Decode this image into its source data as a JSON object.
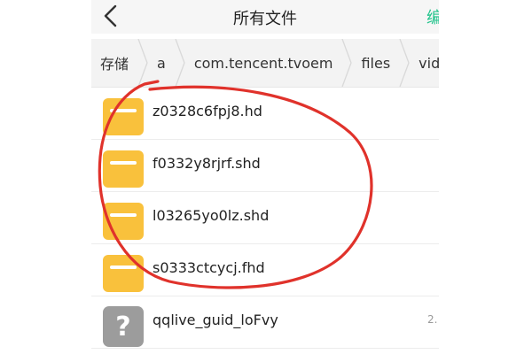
{
  "header": {
    "back_icon": "chevron-left-icon",
    "title": "所有文件",
    "edit_label": "编"
  },
  "breadcrumb": [
    {
      "label": "存储"
    },
    {
      "label": "a"
    },
    {
      "label": "com.tencent.tvoem"
    },
    {
      "label": "files"
    },
    {
      "label": "video"
    }
  ],
  "files": [
    {
      "name": "z0328c6fpj8.hd",
      "icon": "folder-icon",
      "meta": ""
    },
    {
      "name": "f0332y8rjrf.shd",
      "icon": "folder-icon",
      "meta": ""
    },
    {
      "name": "l03265yo0lz.shd",
      "icon": "folder-icon",
      "meta": ""
    },
    {
      "name": "s0333ctcycj.fhd",
      "icon": "folder-icon",
      "meta": ""
    },
    {
      "name": "qqlive_guid_loFvy",
      "icon": "unknown-file-icon",
      "meta": "2."
    }
  ],
  "colors": {
    "folder": "#f9c13c",
    "unknown_file": "#9c9c9c",
    "annotation": "#e0322b",
    "accent": "#25c48d"
  }
}
